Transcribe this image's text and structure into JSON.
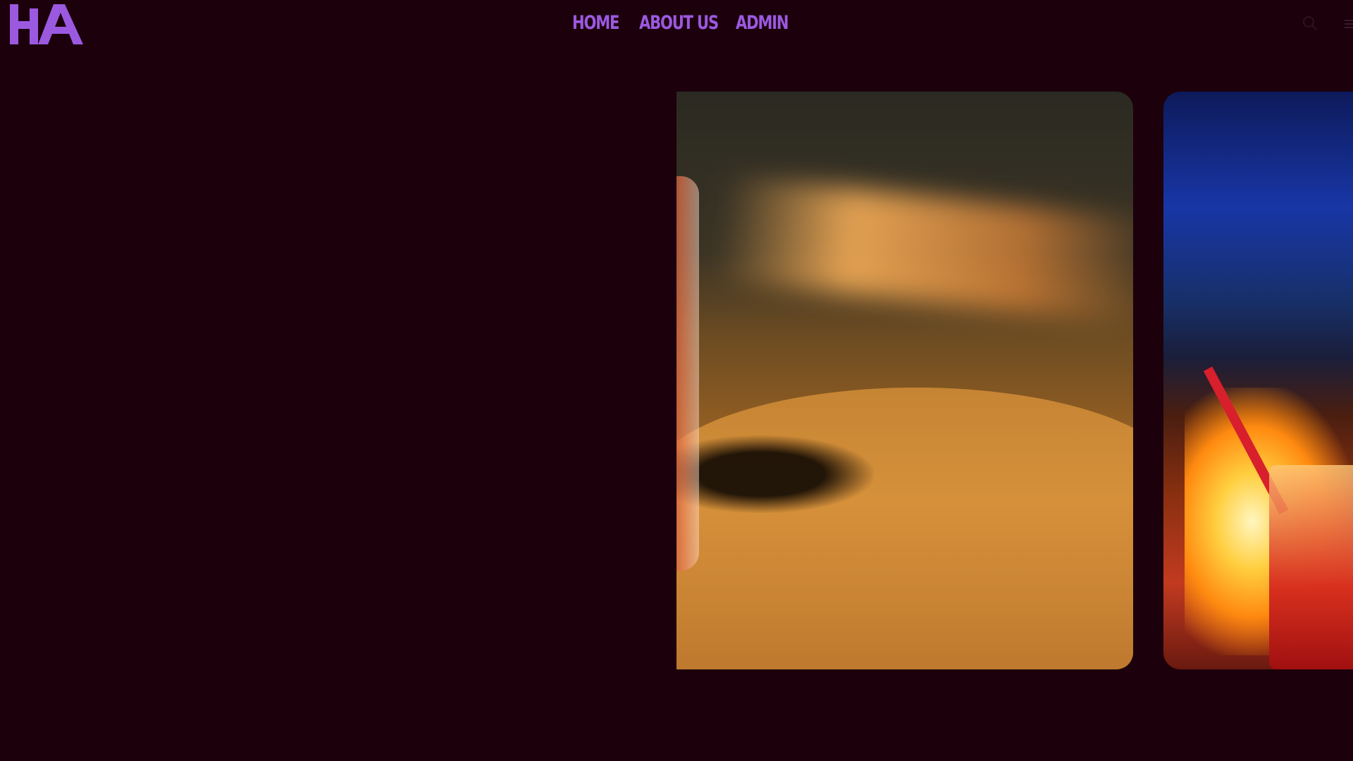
{
  "header": {
    "logo_text": "HA",
    "nav": {
      "home": "HOME",
      "about": "ABOUT US",
      "admin": "ADMIN"
    },
    "search_icon": "search-icon"
  },
  "colors": {
    "background": "#1c000c",
    "accent": "#9b59e0"
  },
  "carousel": {
    "slides": [
      {
        "subject": "cocktail-glass-on-wooden-table"
      },
      {
        "subject": "fiery-cocktail-at-night-beach"
      }
    ]
  }
}
